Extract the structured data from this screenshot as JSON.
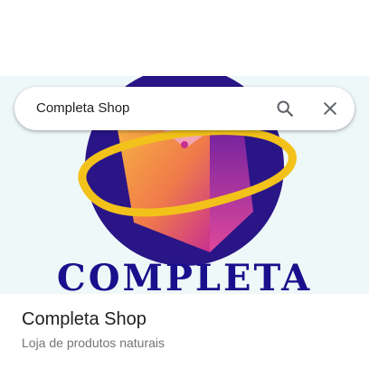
{
  "search": {
    "query": "Completa Shop",
    "search_icon": "search-icon",
    "clear_icon": "close-icon"
  },
  "hero": {
    "logo_text": "COMPLETA",
    "colors": {
      "background": "#eff8f8",
      "circle": "#2a1587",
      "ring": "#f2c21a",
      "bag_orange": "#f6a03c",
      "bag_magenta": "#c8308f",
      "text": "#1a0f8c"
    }
  },
  "place": {
    "name": "Completa Shop",
    "description": "Loja de produtos naturais"
  }
}
